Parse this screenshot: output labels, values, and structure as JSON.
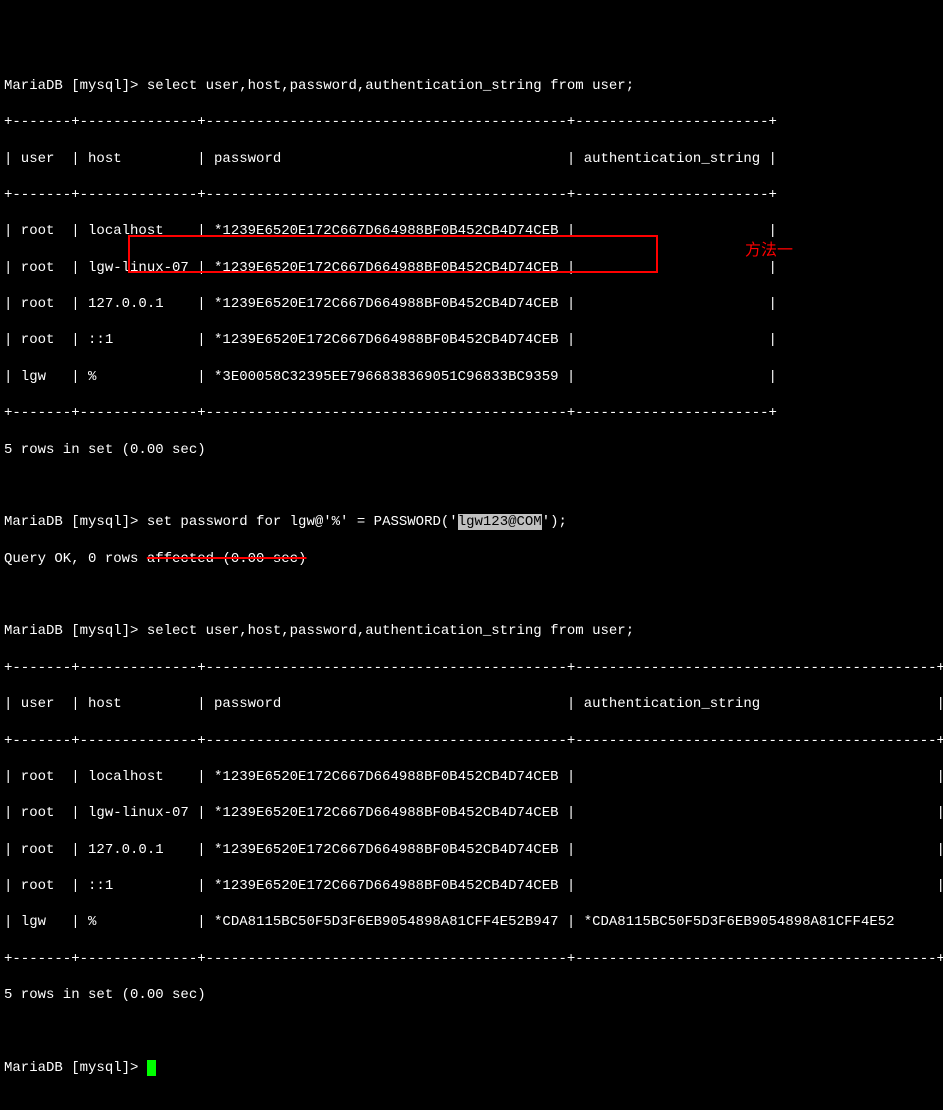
{
  "prompt": "MariaDB [mysql]> ",
  "query1": "select user,host,password,authentication_string from user;",
  "table1": {
    "border_top": "+-------+--------------+-------------------------------------------+-----------------------+",
    "header": "| user  | host         | password                                  | authentication_string |",
    "border_mid": "+-------+--------------+-------------------------------------------+-----------------------+",
    "rows": [
      "| root  | localhost    | *1239E6520E172C667D664988BF0B452CB4D74CEB |                       |",
      "| root  | lgw-linux-07 | *1239E6520E172C667D664988BF0B452CB4D74CEB |                       |",
      "| root  | 127.0.0.1    | *1239E6520E172C667D664988BF0B452CB4D74CEB |                       |",
      "| root  | ::1          | *1239E6520E172C667D664988BF0B452CB4D74CEB |                       |",
      "| lgw   | %            | *3E00058C32395EE7966838369051C96833BC9359 |                       |"
    ],
    "border_bot": "+-------+--------------+-------------------------------------------+-----------------------+"
  },
  "rowcount": "5 rows in set (0.00 sec)",
  "setpwd": {
    "before_sel": "set password for lgw@'%' = PASSWORD('",
    "selected": "lgw123@COM",
    "after_sel": "');"
  },
  "queryok_plain": "Query OK, 0 rows ",
  "queryok_strike": "affected (0.00 sec)",
  "annotation_text": "方法一",
  "table2": {
    "border_top": "+-------+--------------+-------------------------------------------+-------------------------------------------+",
    "header": "| user  | host         | password                                  | authentication_string                     |",
    "border_mid": "+-------+--------------+-------------------------------------------+-------------------------------------------+",
    "rows": [
      "| root  | localhost    | *1239E6520E172C667D664988BF0B452CB4D74CEB |                                           |",
      "| root  | lgw-linux-07 | *1239E6520E172C667D664988BF0B452CB4D74CEB |                                           |",
      "| root  | 127.0.0.1    | *1239E6520E172C667D664988BF0B452CB4D74CEB |                                           |",
      "| root  | ::1          | *1239E6520E172C667D664988BF0B452CB4D74CEB |                                           |",
      "| lgw   | %            | *CDA8115BC50F5D3F6EB9054898A81CFF4E52B947 | *CDA8115BC50F5D3F6EB9054898A81CFF4E52"
    ],
    "border_bot": "+-------+--------------+-------------------------------------------+-------------------------------------------+"
  }
}
